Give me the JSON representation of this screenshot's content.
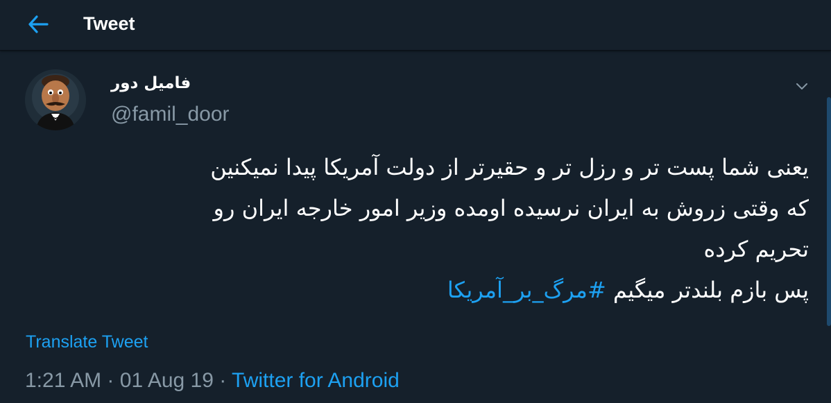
{
  "header": {
    "back_icon": "arrow-left-icon",
    "title": "Tweet"
  },
  "tweet": {
    "author": {
      "name": "فامیل دور",
      "handle": "@famil_door",
      "avatar_icon": "puppet-avatar"
    },
    "more_icon": "chevron-down-icon",
    "text_lines": [
      "یعنی شما پست تر و رزل تر و حقیرتر از دولت آمریکا پیدا نمیکنین",
      "که وقتی زروش به ایران نرسیده اومده وزیر امور خارجه ایران رو",
      "تحریم کرده"
    ],
    "last_line_text": "پس بازم بلندتر میگیم ",
    "hashtag": "#مرگ_بر_آمریکا",
    "translate_label": "Translate Tweet",
    "time": "1:21 AM",
    "separator": "·",
    "date": "01 Aug 19",
    "source": "Twitter for Android"
  },
  "colors": {
    "background": "#15202b",
    "accent": "#1da1f2",
    "secondary_text": "#8899a6"
  }
}
